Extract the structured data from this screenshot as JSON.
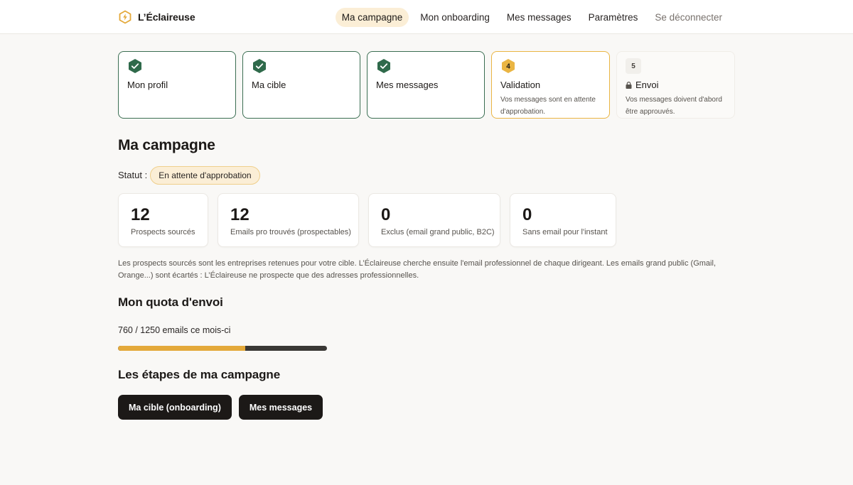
{
  "brand": {
    "name": "L’Éclaireuse"
  },
  "nav": [
    {
      "label": "Ma campagne",
      "active": true
    },
    {
      "label": "Mon onboarding",
      "active": false
    },
    {
      "label": "Mes messages",
      "active": false
    },
    {
      "label": "Paramètres",
      "active": false
    },
    {
      "label": "Se déconnecter",
      "active": false
    }
  ],
  "steps": [
    {
      "state": "done",
      "title": "Mon profil",
      "desc": ""
    },
    {
      "state": "done",
      "title": "Ma cible",
      "desc": ""
    },
    {
      "state": "done",
      "title": "Mes messages",
      "desc": ""
    },
    {
      "state": "current",
      "number": "4",
      "title": "Validation",
      "desc": "Vos messages sont en attente d'approbation."
    },
    {
      "state": "locked",
      "number": "5",
      "title": "Envoi",
      "desc": "Vos messages doivent d'abord être approuvés."
    }
  ],
  "campaign": {
    "title": "Ma campagne",
    "status_label": "Statut :",
    "status_value": "En attente d'approbation"
  },
  "stats": [
    {
      "value": "12",
      "label": "Prospects sourcés"
    },
    {
      "value": "12",
      "label": "Emails pro trouvés (prospectables)"
    },
    {
      "value": "0",
      "label": "Exclus (email grand public, B2C)"
    },
    {
      "value": "0",
      "label": "Sans email pour l'instant"
    }
  ],
  "note": "Les prospects sourcés sont les entreprises retenues pour votre cible. L’Éclaireuse cherche ensuite l'email professionnel de chaque dirigeant. Les emails grand public (Gmail, Orange...) sont écartés : L’Éclaireuse ne prospecte que des adresses professionnelles.",
  "quota": {
    "title": "Mon quota d'envoi",
    "text": "760 / 1250 emails ce mois-ci",
    "used": 760,
    "total": 1250
  },
  "campaign_steps": {
    "title": "Les étapes de ma campagne",
    "buttons": [
      "Ma cible (onboarding)",
      "Mes messages"
    ]
  },
  "colors": {
    "accent": "#e4a93a",
    "done_green": "#2f6a4b",
    "dark": "#1c1917"
  }
}
